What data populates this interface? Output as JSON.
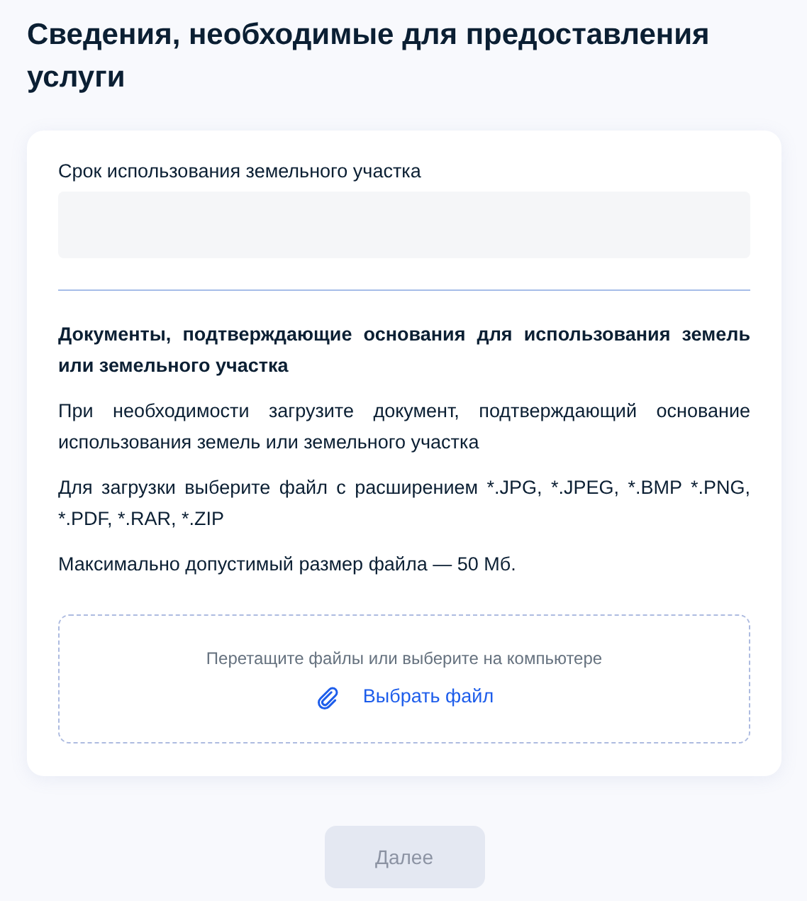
{
  "title": "Сведения, необходимые для предоставления услуги",
  "field": {
    "label": "Срок использования земельного участка"
  },
  "documents": {
    "heading": "Документы, подтверждающие основания для использования земель или земельного участка",
    "paragraphs": [
      "При необходимости загрузите документ, подтверждающий основание использования земель или земельного участка",
      "Для загрузки выберите файл с расширением *.JPG, *.JPEG, *.BMP *.PNG, *.PDF, *.RAR, *.ZIP",
      "Максимально допустимый размер файла — 50 Мб."
    ],
    "dropzone": {
      "hint": "Перетащите файлы или выберите на компьютере",
      "link": "Выбрать файл"
    }
  },
  "next_button": {
    "label": "Далее",
    "disabled": true
  }
}
